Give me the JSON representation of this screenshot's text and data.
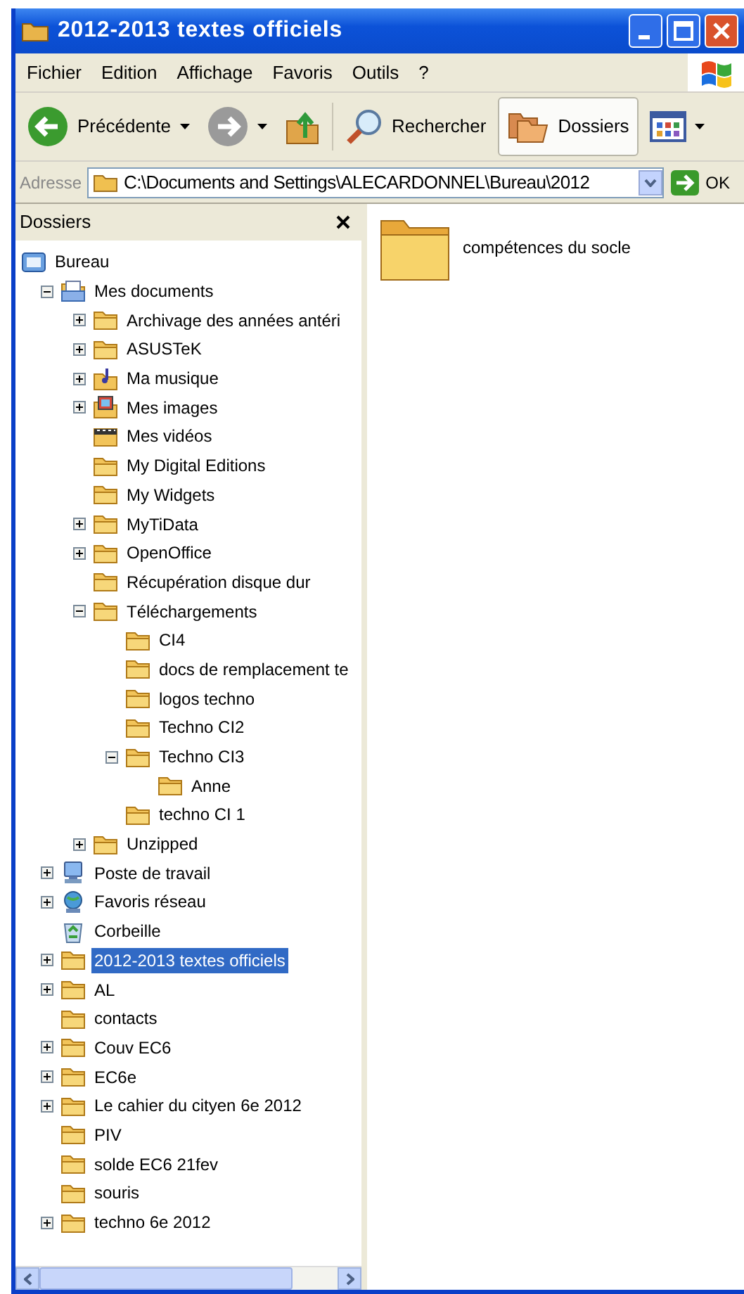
{
  "window": {
    "title": "2012-2013 textes officiels"
  },
  "menu": [
    "Fichier",
    "Edition",
    "Affichage",
    "Favoris",
    "Outils",
    "?"
  ],
  "toolbar": [
    {
      "kind": "back",
      "label": "Précédente",
      "pressed": false
    },
    {
      "kind": "forward",
      "pressed": false
    },
    {
      "kind": "up",
      "pressed": false
    },
    {
      "kind": "search",
      "label": "Rechercher",
      "pressed": false
    },
    {
      "kind": "folders",
      "label": "Dossiers",
      "pressed": true
    },
    {
      "kind": "views",
      "pressed": false
    }
  ],
  "address": {
    "label": "Adresse",
    "value": "C:\\Documents and Settings\\ALECARDONNEL\\Bureau\\2012",
    "go": "OK"
  },
  "folders_pane": {
    "title": "Dossiers",
    "tree": [
      {
        "label": "Bureau",
        "kind": "desktop",
        "expandable": false,
        "selected": false,
        "children": [
          {
            "label": "Mes documents",
            "kind": "documents",
            "expandable": true,
            "expanded": true,
            "selected": false,
            "children": [
              {
                "label": "Archivage des années antéri",
                "kind": "folder",
                "expandable": true,
                "expanded": false,
                "selected": false
              },
              {
                "label": "ASUSTeK",
                "kind": "folder",
                "expandable": true,
                "expanded": false,
                "selected": false
              },
              {
                "label": "Ma musique",
                "kind": "music",
                "expandable": true,
                "expanded": false,
                "selected": false
              },
              {
                "label": "Mes images",
                "kind": "images",
                "expandable": true,
                "expanded": false,
                "selected": false
              },
              {
                "label": "Mes vidéos",
                "kind": "videos",
                "expandable": false,
                "selected": false
              },
              {
                "label": "My Digital Editions",
                "kind": "folder",
                "expandable": false,
                "selected": false
              },
              {
                "label": "My Widgets",
                "kind": "folder",
                "expandable": false,
                "selected": false
              },
              {
                "label": "MyTiData",
                "kind": "folder",
                "expandable": true,
                "expanded": false,
                "selected": false
              },
              {
                "label": "OpenOffice",
                "kind": "folder",
                "expandable": true,
                "expanded": false,
                "selected": false
              },
              {
                "label": "Récupération disque dur",
                "kind": "folder",
                "expandable": false,
                "selected": false
              },
              {
                "label": "Téléchargements",
                "kind": "folder",
                "expandable": true,
                "expanded": true,
                "selected": false,
                "children": [
                  {
                    "label": "CI4",
                    "kind": "folder",
                    "expandable": false,
                    "selected": false
                  },
                  {
                    "label": "docs de remplacement te",
                    "kind": "folder",
                    "expandable": false,
                    "selected": false
                  },
                  {
                    "label": "logos techno",
                    "kind": "folder",
                    "expandable": false,
                    "selected": false
                  },
                  {
                    "label": "Techno CI2",
                    "kind": "folder",
                    "expandable": false,
                    "selected": false
                  },
                  {
                    "label": "Techno CI3",
                    "kind": "folder",
                    "expandable": true,
                    "expanded": true,
                    "selected": false,
                    "children": [
                      {
                        "label": "Anne",
                        "kind": "folder",
                        "expandable": false,
                        "selected": false
                      }
                    ]
                  },
                  {
                    "label": "techno CI 1",
                    "kind": "folder",
                    "expandable": false,
                    "selected": false
                  }
                ]
              },
              {
                "label": "Unzipped",
                "kind": "folder",
                "expandable": true,
                "expanded": false,
                "selected": false
              }
            ]
          },
          {
            "label": "Poste de travail",
            "kind": "computer",
            "expandable": true,
            "expanded": false,
            "selected": false
          },
          {
            "label": "Favoris réseau",
            "kind": "network",
            "expandable": true,
            "expanded": false,
            "selected": false
          },
          {
            "label": "Corbeille",
            "kind": "recycle",
            "expandable": false,
            "selected": false
          },
          {
            "label": "2012-2013 textes officiels",
            "kind": "folder",
            "expandable": true,
            "expanded": false,
            "selected": true
          },
          {
            "label": "AL",
            "kind": "folder",
            "expandable": true,
            "expanded": false,
            "selected": false
          },
          {
            "label": "contacts",
            "kind": "folder",
            "expandable": false,
            "selected": false
          },
          {
            "label": "Couv EC6",
            "kind": "folder",
            "expandable": true,
            "expanded": false,
            "selected": false
          },
          {
            "label": "EC6e",
            "kind": "folder",
            "expandable": true,
            "expanded": false,
            "selected": false
          },
          {
            "label": "Le cahier du cityen 6e 2012",
            "kind": "folder",
            "expandable": true,
            "expanded": false,
            "selected": false
          },
          {
            "label": "PIV",
            "kind": "folder",
            "expandable": false,
            "selected": false
          },
          {
            "label": "solde EC6 21fev",
            "kind": "folder",
            "expandable": false,
            "selected": false
          },
          {
            "label": "souris",
            "kind": "folder",
            "expandable": false,
            "selected": false
          },
          {
            "label": "techno 6e 2012",
            "kind": "folder",
            "expandable": true,
            "expanded": false,
            "selected": false
          }
        ]
      }
    ]
  },
  "content": {
    "items": [
      {
        "label": "compétences du socle"
      }
    ]
  }
}
